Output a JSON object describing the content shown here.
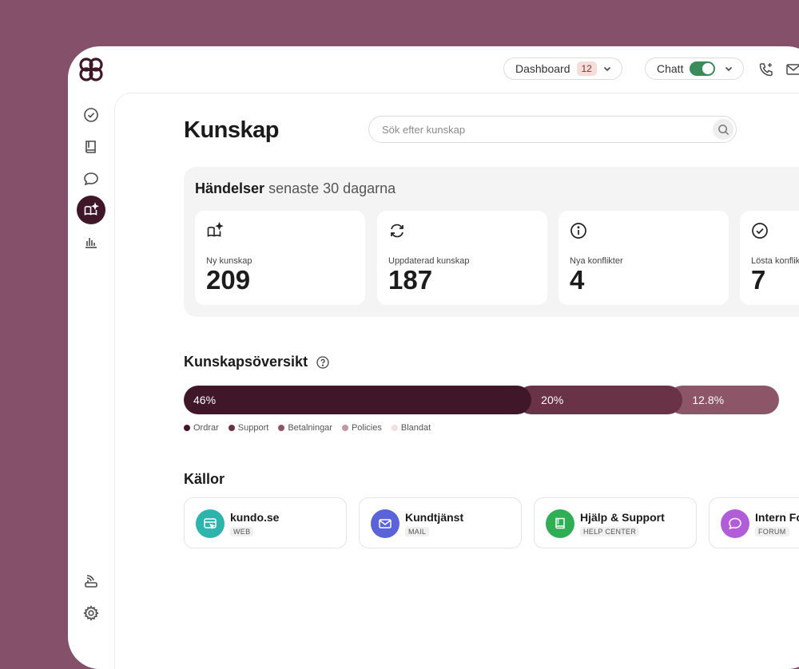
{
  "topbar": {
    "dashboard_label": "Dashboard",
    "dashboard_count": "12",
    "chat_label": "Chatt"
  },
  "page": {
    "title": "Kunskap",
    "search_placeholder": "Sök efter kunskap"
  },
  "events": {
    "title_bold": "Händelser",
    "title_rest": "senaste 30 dagarna",
    "stats": [
      {
        "label": "Ny kunskap",
        "value": "209",
        "icon": "book-sparkle-icon"
      },
      {
        "label": "Uppdaterad kunskap",
        "value": "187",
        "icon": "refresh-icon"
      },
      {
        "label": "Nya konflikter",
        "value": "4",
        "icon": "info-icon"
      },
      {
        "label": "Lösta konflikter",
        "value": "7",
        "icon": "check-circle-icon"
      }
    ]
  },
  "overview": {
    "title": "Kunskapsöversikt",
    "segments": [
      {
        "label": "46%",
        "value": 46,
        "color": "#3f1729"
      },
      {
        "label": "20%",
        "value": 20,
        "color": "#693247"
      },
      {
        "label": "12.8%",
        "value": 12.8,
        "color": "#8c5568"
      }
    ],
    "legend": [
      {
        "label": "Ordrar",
        "color": "#3f1729"
      },
      {
        "label": "Support",
        "color": "#693247"
      },
      {
        "label": "Betalningar",
        "color": "#8c5568"
      },
      {
        "label": "Policies",
        "color": "#c098a6"
      },
      {
        "label": "Blandat",
        "color": "#f3dfe0"
      }
    ]
  },
  "sources": {
    "title": "Källor",
    "items": [
      {
        "name": "kundo.se",
        "type": "WEB",
        "color": "#2fb3ad",
        "icon": "web-icon"
      },
      {
        "name": "Kundtjänst",
        "type": "MAIL",
        "color": "#5a63d8",
        "icon": "mail-icon"
      },
      {
        "name": "Hjälp & Support",
        "type": "HELP CENTER",
        "color": "#2fae55",
        "icon": "book-icon"
      },
      {
        "name": "Intern Forum",
        "type": "FORUM",
        "color": "#b25dd8",
        "icon": "chat-icon"
      }
    ]
  }
}
